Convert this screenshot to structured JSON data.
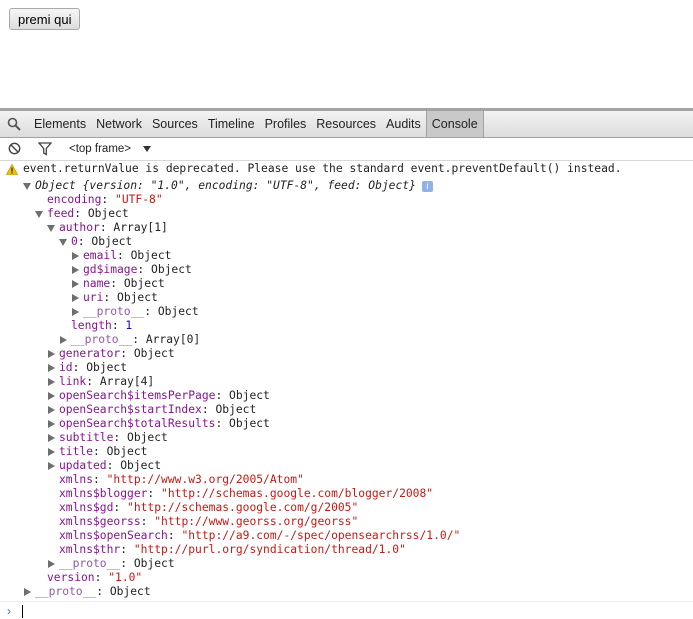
{
  "page": {
    "button_label": "premi qui"
  },
  "devtools": {
    "tabs": [
      {
        "label": "Elements",
        "selected": false
      },
      {
        "label": "Network",
        "selected": false
      },
      {
        "label": "Sources",
        "selected": false
      },
      {
        "label": "Timeline",
        "selected": false
      },
      {
        "label": "Profiles",
        "selected": false
      },
      {
        "label": "Resources",
        "selected": false
      },
      {
        "label": "Audits",
        "selected": false
      },
      {
        "label": "Console",
        "selected": true
      }
    ],
    "frame_select": "<top frame>",
    "icons": {
      "search": "search-icon",
      "clear": "clear-console-icon",
      "filter": "filter-icon",
      "warning": "warning-icon",
      "info": "info-icon"
    },
    "colors": {
      "property": "#881391",
      "string": "#c41a16",
      "number": "#1c00cf",
      "prompt": "#2d7ad3"
    }
  },
  "console": {
    "warning": "event.returnValue is deprecated. Please use the standard event.preventDefault() instead.",
    "preview": "Object {version: \"1.0\", encoding: \"UTF-8\", feed: Object}",
    "lines": [
      {
        "key": "encoding",
        "value": "\"UTF-8\"",
        "type": "string"
      },
      {
        "key": "feed",
        "value": "Object",
        "type": "object"
      },
      {
        "key": "author",
        "value": "Array[1]",
        "type": "object"
      },
      {
        "key": "0",
        "value": "Object",
        "type": "object"
      },
      {
        "key": "email",
        "value": "Object",
        "type": "object"
      },
      {
        "key": "gd$image",
        "value": "Object",
        "type": "object"
      },
      {
        "key": "name",
        "value": "Object",
        "type": "object"
      },
      {
        "key": "uri",
        "value": "Object",
        "type": "object"
      },
      {
        "key": "__proto__",
        "value": "Object",
        "type": "object"
      },
      {
        "key": "length",
        "value": "1",
        "type": "number"
      },
      {
        "key": "__proto__",
        "value": "Array[0]",
        "type": "object"
      },
      {
        "key": "generator",
        "value": "Object",
        "type": "object"
      },
      {
        "key": "id",
        "value": "Object",
        "type": "object"
      },
      {
        "key": "link",
        "value": "Array[4]",
        "type": "object"
      },
      {
        "key": "openSearch$itemsPerPage",
        "value": "Object",
        "type": "object"
      },
      {
        "key": "openSearch$startIndex",
        "value": "Object",
        "type": "object"
      },
      {
        "key": "openSearch$totalResults",
        "value": "Object",
        "type": "object"
      },
      {
        "key": "subtitle",
        "value": "Object",
        "type": "object"
      },
      {
        "key": "title",
        "value": "Object",
        "type": "object"
      },
      {
        "key": "updated",
        "value": "Object",
        "type": "object"
      },
      {
        "key": "xmlns",
        "value": "\"http://www.w3.org/2005/Atom\"",
        "type": "string"
      },
      {
        "key": "xmlns$blogger",
        "value": "\"http://schemas.google.com/blogger/2008\"",
        "type": "string"
      },
      {
        "key": "xmlns$gd",
        "value": "\"http://schemas.google.com/g/2005\"",
        "type": "string"
      },
      {
        "key": "xmlns$georss",
        "value": "\"http://www.georss.org/georss\"",
        "type": "string"
      },
      {
        "key": "xmlns$openSearch",
        "value": "\"http://a9.com/-/spec/opensearchrss/1.0/\"",
        "type": "string"
      },
      {
        "key": "xmlns$thr",
        "value": "\"http://purl.org/syndication/thread/1.0\"",
        "type": "string"
      },
      {
        "key": "__proto__",
        "value": "Object",
        "type": "object"
      },
      {
        "key": "version",
        "value": "\"1.0\"",
        "type": "string"
      },
      {
        "key": "__proto__",
        "value": "Object",
        "type": "object"
      }
    ]
  }
}
